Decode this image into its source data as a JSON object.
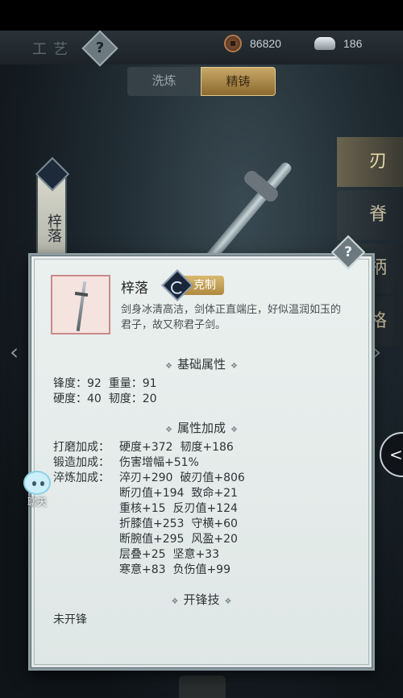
{
  "header": {
    "title_art": "工艺",
    "help_glyph": "?",
    "copper_amount": "86820",
    "silver_amount": "186"
  },
  "tabs": [
    {
      "label": "洗炼",
      "active": false
    },
    {
      "label": "精铸",
      "active": true
    }
  ],
  "right_tabs": [
    {
      "label": "刃",
      "active": true
    },
    {
      "label": "脊",
      "active": false
    },
    {
      "label": "柄",
      "active": false
    },
    {
      "label": "格",
      "active": false
    }
  ],
  "left_banner": {
    "label": "梓落"
  },
  "panel": {
    "help_glyph": "?",
    "item": {
      "name": "梓落",
      "counter_label": "克制",
      "description": "剑身冰清高洁，剑体正直端庄，好似温润如玉的君子，故又称君子剑。"
    },
    "basic": {
      "title": "基础属性",
      "lines": [
        "锋度：92  重量：91",
        "硬度：40  韧度：20"
      ]
    },
    "bonus": {
      "title": "属性加成",
      "groups": [
        {
          "label": "打磨加成：",
          "lines": [
            "硬度+372  韧度+186"
          ]
        },
        {
          "label": "锻造加成：",
          "lines": [
            "伤害增幅+51%"
          ]
        },
        {
          "label": "淬炼加成：",
          "lines": [
            "淬刃+290  破刃值+806",
            "断刃值+194  致命+21",
            "重核+15  反刃值+124",
            "折膝值+253  守横+60",
            "断腕值+295  风盈+20",
            "层叠+25  坚意+33",
            "寒意+83  负伤值+99"
          ]
        }
      ]
    },
    "skill": {
      "title": "开锋技",
      "value": "未开锋"
    }
  },
  "chat": {
    "label": "聊天"
  },
  "side_toggle": {
    "glyph": "<"
  },
  "colors": {
    "panel_bg": "#eaf0ee",
    "panel_border": "#8c9ca0",
    "active_tab": "#c8a868",
    "counter_badge": "#d8b870"
  },
  "icons": [
    "coin-icon",
    "silver-ingot-icon",
    "help-icon",
    "sword-icon",
    "crescent-moon-icon",
    "chat-bubble-icon",
    "chevron-left-icon"
  ]
}
